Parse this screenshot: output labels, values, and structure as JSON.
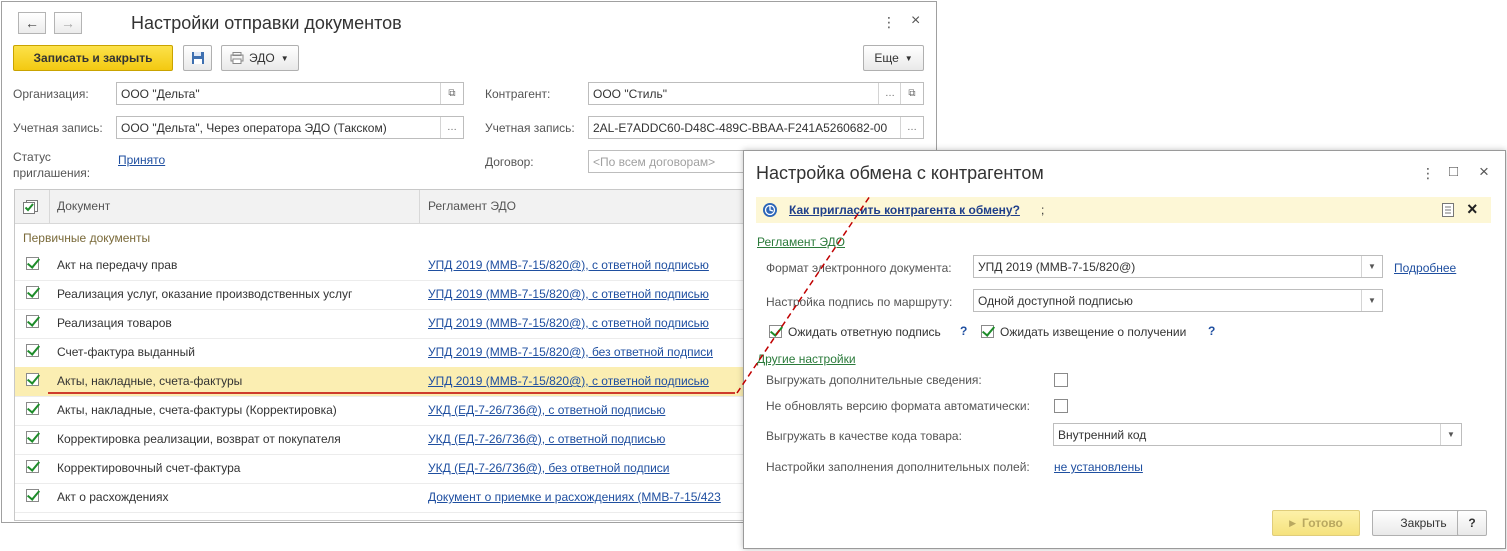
{
  "main": {
    "title": "Настройки отправки документов",
    "nav_back": "←",
    "nav_forward": "→",
    "menu_glyph": "⋮",
    "close_glyph": "×",
    "toolbar": {
      "save_close": "Записать и закрыть",
      "edo": "ЭДО",
      "more": "Еще"
    },
    "org_label": "Организация:",
    "org_value": "ООО \"Дельта\"",
    "account_label": "Учетная запись:",
    "account_value": "ООО \"Дельта\", Через оператора ЭДО (Такском)",
    "status_label_1": "Статус",
    "status_label_2": "приглашения:",
    "status_value": "Принято",
    "counterparty_label": "Контрагент:",
    "counterparty_value": "ООО \"Стиль\"",
    "cp_account_label": "Учетная запись:",
    "cp_account_value": "2AL-E7ADDC60-D48C-489C-BBAA-F241A5260682-00",
    "contract_label": "Договор:",
    "contract_placeholder": "<По всем договорам>",
    "table": {
      "col_doc": "Документ",
      "col_reg": "Регламент ЭДО",
      "group": "Первичные документы",
      "rows": [
        {
          "doc": "Акт на передачу прав",
          "reg": "УПД 2019 (ММВ-7-15/820@), с ответной подписью"
        },
        {
          "doc": "Реализация услуг, оказание производственных услуг",
          "reg": "УПД 2019 (ММВ-7-15/820@), с ответной подписью"
        },
        {
          "doc": "Реализация товаров",
          "reg": "УПД 2019 (ММВ-7-15/820@), с ответной подписью"
        },
        {
          "doc": "Счет-фактура выданный",
          "reg": "УПД 2019 (ММВ-7-15/820@), без ответной подписи"
        },
        {
          "doc": "Акты, накладные, счета-фактуры",
          "reg": "УПД 2019 (ММВ-7-15/820@), с ответной подписью"
        },
        {
          "doc": "Акты, накладные, счета-фактуры (Корректировка)",
          "reg": "УКД (ЕД-7-26/736@), с ответной подписью"
        },
        {
          "doc": "Корректировка реализации, возврат от покупателя",
          "reg": "УКД (ЕД-7-26/736@), с ответной подписью"
        },
        {
          "doc": "Корректировочный счет-фактура",
          "reg": "УКД (ЕД-7-26/736@), без ответной подписи"
        },
        {
          "doc": "Акт о расхождениях",
          "reg": "Документ о приемке и расхождениях (ММВ-7-15/423"
        }
      ]
    }
  },
  "dialog": {
    "title": "Настройка обмена с контрагентом",
    "menu_glyph": "⋮",
    "maximize_glyph": "□",
    "close_glyph": "×",
    "info_link": "Как пригласить контрагента к обмену?",
    "info_suffix": ";",
    "section_reglament": "Регламент ЭДО",
    "format_label": "Формат электронного документа:",
    "format_value": "УПД 2019 (ММВ-7-15/820@)",
    "details_link": "Подробнее",
    "sign_label": "Настройка подпись по маршруту:",
    "sign_value": "Одной доступной подписью",
    "wait_sign_label": "Ожидать ответную подпись",
    "wait_notice_label": "Ожидать извещение о получении",
    "q": "?",
    "section_other": "Другие настройки",
    "extra_info_label": "Выгружать дополнительные сведения:",
    "no_update_label": "Не обновлять версию формата автоматически:",
    "code_label": "Выгружать в качестве кода товара:",
    "code_value": "Внутренний код",
    "fill_label": "Настройки заполнения дополнительных полей:",
    "fill_value": "не установлены",
    "ok": "Готово",
    "close": "Закрыть",
    "help": "?"
  }
}
